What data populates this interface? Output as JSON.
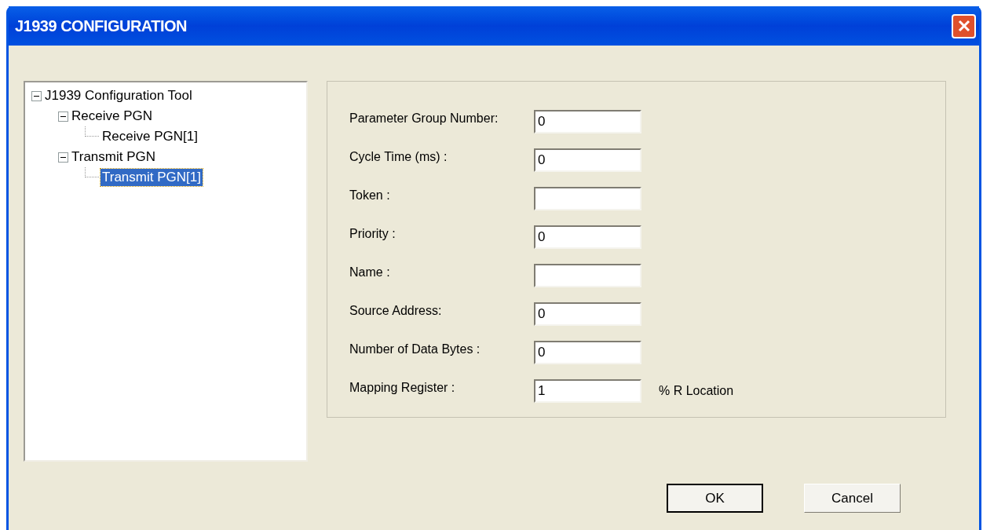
{
  "window": {
    "title": "J1939 CONFIGURATION"
  },
  "tree": [
    {
      "label": "J1939 Configuration Tool",
      "expanded": true,
      "selected": false,
      "children": [
        {
          "label": "Receive PGN",
          "expanded": true,
          "selected": false,
          "children": [
            {
              "label": "Receive PGN[1]",
              "selected": false
            }
          ]
        },
        {
          "label": "Transmit PGN",
          "expanded": true,
          "selected": false,
          "children": [
            {
              "label": "Transmit PGN[1]",
              "selected": true
            }
          ]
        }
      ]
    }
  ],
  "fields": [
    {
      "label": "Parameter Group Number:",
      "value": "0"
    },
    {
      "label": "Cycle Time (ms) :",
      "value": "0"
    },
    {
      "label": "Token :"
    },
    {
      "label": "Priority :",
      "value": "0"
    },
    {
      "label": "Name :"
    },
    {
      "label": "Source Address:",
      "value": "0"
    },
    {
      "label": "Number of Data Bytes :",
      "value": "0"
    },
    {
      "label": "Mapping Register :",
      "value": "1",
      "suffix": "% R Location"
    }
  ],
  "buttons": [
    {
      "label": "OK",
      "default": true
    },
    {
      "label": "Cancel",
      "default": false
    }
  ]
}
